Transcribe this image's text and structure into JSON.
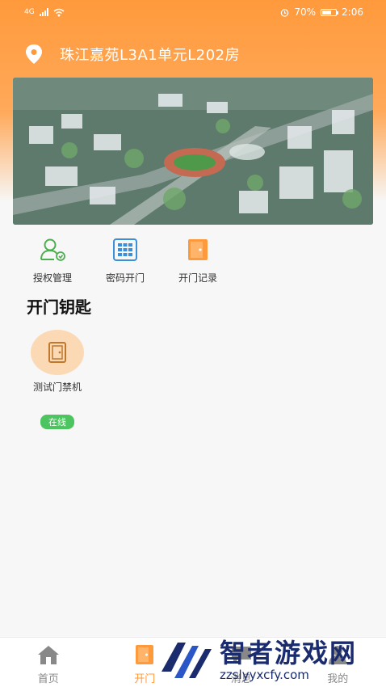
{
  "status_bar": {
    "network": "4G",
    "battery": "70%",
    "battery_level": 0.7,
    "time": "2:06"
  },
  "header": {
    "address": "珠江嘉苑L3A1单元L202房",
    "location_icon": "location-pin-icon"
  },
  "colors": {
    "accent": "#ff9a3c",
    "online": "#4cc45f",
    "device_bg": "#fcd9b5",
    "authorize_icon": "#4cae4f",
    "password_icon": "#3b8fd9",
    "record_icon": "#ff9a3c"
  },
  "quick_actions": [
    {
      "label": "授权管理",
      "icon": "user-authorize-icon"
    },
    {
      "label": "密码开门",
      "icon": "keypad-icon"
    },
    {
      "label": "开门记录",
      "icon": "door-record-icon"
    }
  ],
  "keys_section": {
    "title": "开门钥匙",
    "devices": [
      {
        "name": "测试门禁机",
        "status": "在线",
        "icon": "door-icon"
      }
    ]
  },
  "tab_bar": {
    "items": [
      {
        "label": "首页",
        "icon": "home-icon",
        "active": false
      },
      {
        "label": "开门",
        "icon": "door-icon",
        "active": true
      },
      {
        "label": "消息",
        "icon": "message-icon",
        "active": false
      },
      {
        "label": "我的",
        "icon": "profile-icon",
        "active": false
      }
    ]
  },
  "watermark": {
    "title": "智者游戏网",
    "url": "zzslyyxcfy.com"
  }
}
